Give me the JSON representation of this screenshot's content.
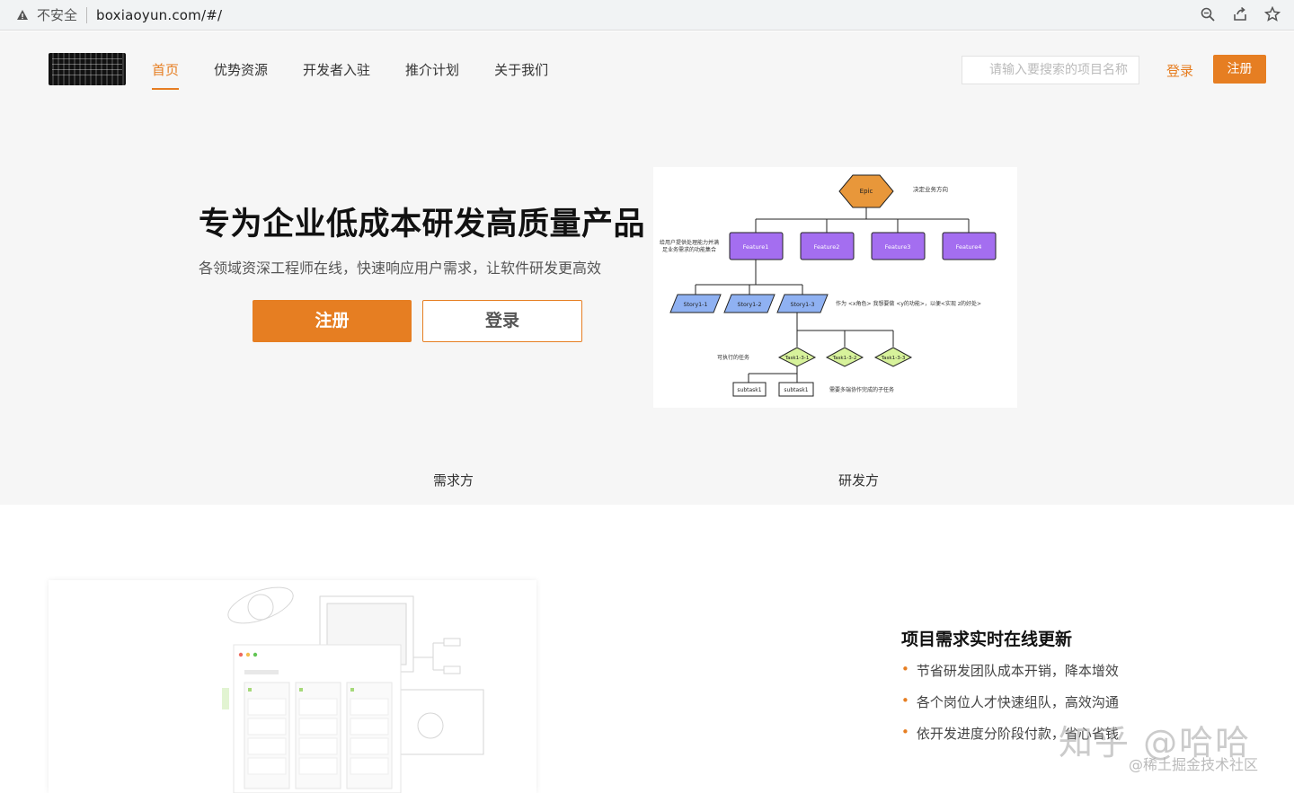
{
  "browser": {
    "insecure_label": "不安全",
    "url": "boxiaoyun.com/#/"
  },
  "nav": {
    "items": [
      {
        "label": "首页",
        "active": true
      },
      {
        "label": "优势资源"
      },
      {
        "label": "开发者入驻"
      },
      {
        "label": "推介计划"
      },
      {
        "label": "关于我们"
      }
    ],
    "search_placeholder": "请输入要搜索的项目名称",
    "login": "登录",
    "register": "注册"
  },
  "hero": {
    "title": "专为企业低成本研发高质量产品",
    "subtitle": "各领域资深工程师在线，快速响应用户需求，让软件研发更高效",
    "register_button": "注册",
    "login_button": "登录"
  },
  "diagram": {
    "epic": "Epic",
    "epic_note": "决定业务方向",
    "feature_note_1": "给用户提供处理能力并满",
    "feature_note_2": "足业务需求的功能集合",
    "features": [
      "Feature1",
      "Feature2",
      "Feature3",
      "Feature4"
    ],
    "stories": [
      "Story1-1",
      "Story1-2",
      "Story1-3"
    ],
    "story_note": "作为 <x角色> 我想要做 <y的功能>，以便<实现 z的好处>",
    "task_note": "可执行的任务",
    "tasks": [
      "Task1-3-1",
      "Task1-3-2",
      "Task1-3-3"
    ],
    "subtasks": [
      "subtask1",
      "subtask1"
    ],
    "subtask_note": "需要多端协作完成的子任务"
  },
  "tabs": {
    "demand": "需求方",
    "developer": "研发方"
  },
  "feature": {
    "title": "项目需求实时在线更新",
    "points": [
      "节省研发团队成本开销，降本增效",
      "各个岗位人才快速组队，高效沟通",
      "依开发进度分阶段付款，省心省钱"
    ]
  },
  "watermark": {
    "main": "知乎 @哈哈",
    "sub": "@稀土掘金技术社区"
  },
  "colors": {
    "accent": "#e67e22",
    "epic": "#e8973a",
    "feature": "#a46ef0",
    "story": "#8fb1f2",
    "task": "#d7f29b"
  }
}
